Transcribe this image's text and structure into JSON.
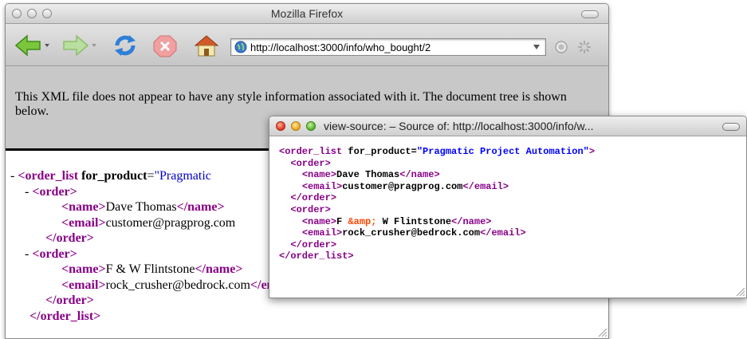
{
  "window": {
    "title": "Mozilla Firefox"
  },
  "toolbar": {
    "back_icon": "back-arrow-icon",
    "forward_icon": "forward-arrow-icon",
    "reload_icon": "reload-icon",
    "stop_icon": "stop-icon",
    "home_icon": "home-icon",
    "url": "http://localhost:3000/info/who_bought/2"
  },
  "page": {
    "info_text": "This XML file does not appear to have any style information associated with it. The document tree is shown below."
  },
  "tree": {
    "root_tag": "<order_list",
    "root_attr": "for_product",
    "root_val_partial": "\"Pragmatic",
    "root_close": "</order_list>",
    "orders": [
      {
        "open": "<order>",
        "name_open": "<name>",
        "name_value": "Dave Thomas",
        "name_close": "</name>",
        "email_open": "<email>",
        "email_value": "customer@pragprog.com",
        "close": "</order>"
      },
      {
        "open": "<order>",
        "name_open": "<name>",
        "name_value": "F & W Flintstone",
        "name_close": "</name>",
        "email_open": "<email>",
        "email_value": "rock_crusher@bedrock.com",
        "email_close": "</email>",
        "close": "</order>"
      }
    ]
  },
  "source_window": {
    "title": "view-source: – Source of: http://localhost:3000/info/w...",
    "root_open": "<order_list",
    "root_attr": "for_product",
    "root_eq": "=",
    "root_val": "\"Pragmatic Project Automation\"",
    "root_end": ">",
    "order_open": "<order>",
    "order_close": "</order>",
    "name_open": "<name>",
    "name_close": "</name>",
    "email_open": "<email>",
    "email_close": "</email>",
    "o1_name": "Dave Thomas",
    "o1_email": "customer@pragprog.com",
    "o2_name_a": "F ",
    "o2_name_entity": "&amp;",
    "o2_name_b": " W Flintstone",
    "o2_email": "rock_crusher@bedrock.com",
    "root_close": "</order_list>"
  },
  "colors": {
    "tag": "#880088",
    "attr_value": "#0000ff",
    "entity": "#ff4500",
    "info_bar": "#c8c8c8"
  }
}
